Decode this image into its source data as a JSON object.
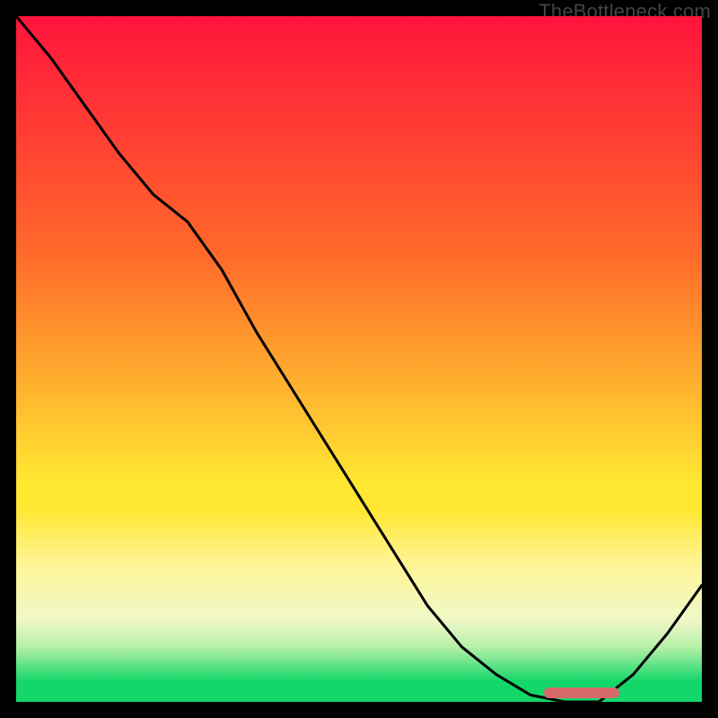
{
  "watermark": "TheBottleneck.com",
  "chart_data": {
    "type": "line",
    "title": "",
    "xlabel": "",
    "ylabel": "",
    "x": [
      0.0,
      0.05,
      0.1,
      0.15,
      0.2,
      0.25,
      0.3,
      0.35,
      0.4,
      0.45,
      0.5,
      0.55,
      0.6,
      0.65,
      0.7,
      0.75,
      0.8,
      0.825,
      0.85,
      0.9,
      0.95,
      1.0
    ],
    "y": [
      1.0,
      0.94,
      0.87,
      0.8,
      0.74,
      0.7,
      0.63,
      0.54,
      0.46,
      0.38,
      0.3,
      0.22,
      0.14,
      0.08,
      0.04,
      0.01,
      0.0,
      0.0,
      0.0,
      0.04,
      0.1,
      0.17
    ],
    "xlim": [
      0,
      1
    ],
    "ylim": [
      0,
      1
    ],
    "gradient_background": {
      "top": "#ff143c",
      "mid": "#ffe732",
      "bottom": "#14d76a"
    },
    "optimum_marker": {
      "x_start": 0.77,
      "x_end": 0.88,
      "y": 0.005,
      "color": "#d66a6a"
    }
  }
}
